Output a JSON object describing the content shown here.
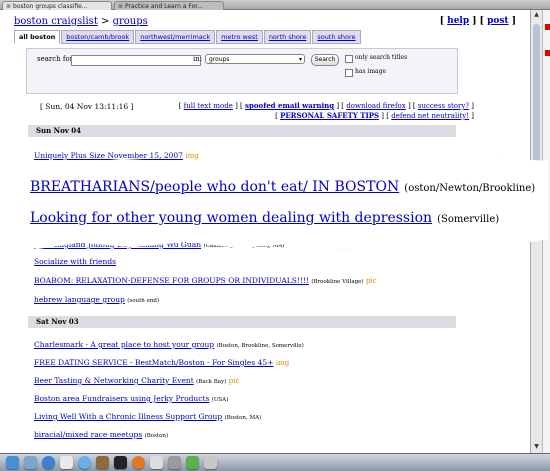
{
  "browser": {
    "tabs": [
      {
        "label": "boston groups classifie...",
        "active": true
      },
      {
        "label": "Practice and Learn a For...",
        "active": false
      }
    ]
  },
  "header": {
    "breadcrumb_site": "boston craigslist",
    "breadcrumb_sep": ">",
    "breadcrumb_section": "groups",
    "help": "help",
    "post": "post"
  },
  "areas": [
    "all boston",
    "boston/camb/brook",
    "northwest/merrimack",
    "metro west",
    "north shore",
    "south shore"
  ],
  "search": {
    "label": "search for:",
    "value": "",
    "in_label": "in:",
    "category": "groups",
    "button": "Search",
    "only_titles": "only search titles",
    "has_image": "has image"
  },
  "datebar": "[ Sun, 04 Nov 13:11:16 ]",
  "links": {
    "full_text_mode": "full text mode",
    "spoofed_email": "spoofed email warning",
    "download_firefox": "download firefox",
    "success_story": "success story?",
    "safety_tips": "PERSONAL SAFETY TIPS",
    "net_neutrality": "defend net neutrality!"
  },
  "days": [
    {
      "label": "Sun Nov 04",
      "posts": [
        {
          "title": "Uniquely Plus Size November 15, 2007",
          "location": "",
          "tag": "img"
        },
        {
          "title": "New England Jiulong Baguazhang Wu Guan",
          "location": "(Cambridge and Quincy, MA)",
          "tag": ""
        },
        {
          "title": "Socialize with friends",
          "location": "",
          "tag": ""
        },
        {
          "title": "BOABOM: RELAXATION-DEFENSE FOR GROUPS OR INDIVIDUALS!!!!",
          "location": "(Brookline Village)",
          "tag": "pic"
        },
        {
          "title": "hebrew language group",
          "location": "(south end)",
          "tag": ""
        }
      ]
    },
    {
      "label": "Sat Nov 03",
      "posts": [
        {
          "title": "Charlesmark - A great place to host your group",
          "location": "(Boston, Brookline, Somerville)",
          "tag": ""
        },
        {
          "title": "FREE DATING SERVICE - BestMatch/Boston - For Singles 45+",
          "location": "",
          "tag": "img"
        },
        {
          "title": "Beer Tasting & Networking Charity Event",
          "location": "(Back Bay)",
          "tag": "pic"
        },
        {
          "title": "Boston area Fundraisers using Jerky Products",
          "location": "(USA)",
          "tag": ""
        },
        {
          "title": "Living Well With a Chronic Illness Support Group",
          "location": "(Boston, MA)",
          "tag": ""
        },
        {
          "title": "biracial/mixed race meetups",
          "location": "(Boston)",
          "tag": ""
        }
      ]
    }
  ],
  "callout": {
    "posts": [
      {
        "title": "BREATHARIANS/people who don't eat/ IN BOSTON",
        "location": "(oston/Newton/Brookline)"
      },
      {
        "title": "Looking for other young women dealing with depression",
        "location": "(Somerville)"
      }
    ]
  },
  "colors": {
    "link": "#0000cc",
    "tag": "#e08a00",
    "day_header_bg": "#dcdce2"
  },
  "dock_icons": [
    "finder-icon",
    "mail-icon",
    "safari-icon",
    "calendar-icon",
    "itunes-icon",
    "photos-icon",
    "terminal-icon",
    "firefox-icon",
    "x11-icon",
    "preferences-icon",
    "chat-icon",
    "trash-icon"
  ]
}
